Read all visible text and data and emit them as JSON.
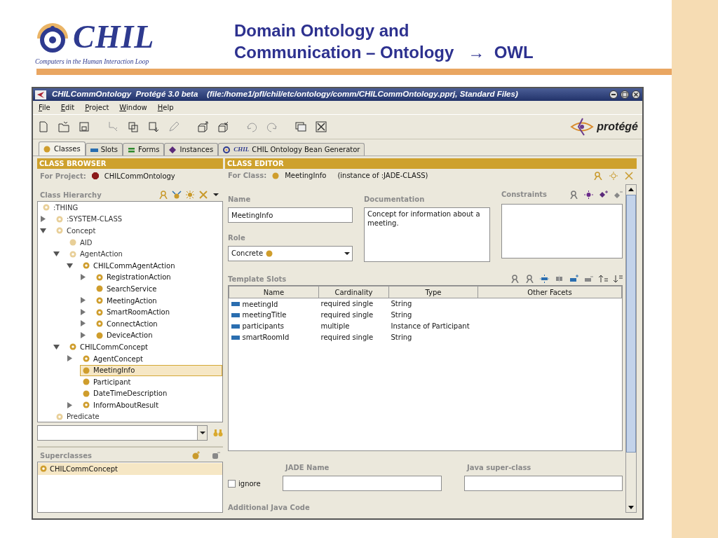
{
  "slide": {
    "logo": {
      "name": "CHIL",
      "tagline": "Computers in the Human Interaction Loop"
    },
    "title_lines": [
      "Domain Ontology and",
      "Communication – Ontology   →  OWL"
    ]
  },
  "window": {
    "title": "CHILCommOntology  Protégé 3.0 beta    (file:/home1/pfl/chil/etc/ontology/comm/CHILCommOntology.pprj, Standard Files)"
  },
  "menu": [
    "File",
    "Edit",
    "Project",
    "Window",
    "Help"
  ],
  "brand": "protégé",
  "tabs": [
    {
      "label": "Classes",
      "kind": "classes",
      "selected": true
    },
    {
      "label": "Slots",
      "kind": "slots",
      "selected": false
    },
    {
      "label": "Forms",
      "kind": "forms",
      "selected": false
    },
    {
      "label": "Instances",
      "kind": "instances",
      "selected": false
    },
    {
      "label": "CHIL Ontology Bean Generator",
      "logo": "CHIL",
      "kind": "plugin",
      "selected": false
    }
  ],
  "class_browser": {
    "header": "CLASS BROWSER",
    "project_label": "For Project:",
    "project": "CHILCommOntology",
    "hierarchy_label": "Class Hierarchy",
    "tree": [
      {
        "label": ":THING",
        "kind": "abstract",
        "system": true,
        "selected": false,
        "children": [
          {
            "label": ":SYSTEM-CLASS",
            "kind": "abstract",
            "system": true,
            "selected": false,
            "expanded": false
          },
          {
            "label": "Concept",
            "kind": "abstract",
            "system": true,
            "selected": false,
            "expanded": true,
            "children": [
              {
                "label": "AID",
                "kind": "concrete",
                "system": true,
                "selected": false
              },
              {
                "label": "AgentAction",
                "kind": "abstract",
                "system": true,
                "selected": false,
                "expanded": true,
                "children": [
                  {
                    "label": "CHILCommAgentAction",
                    "kind": "abstract",
                    "system": false,
                    "selected": false,
                    "expanded": true,
                    "children": [
                      {
                        "label": "RegistrationAction",
                        "kind": "abstract",
                        "system": false,
                        "selected": false,
                        "expanded": false
                      },
                      {
                        "label": "SearchService",
                        "kind": "concrete",
                        "system": false,
                        "selected": false
                      },
                      {
                        "label": "MeetingAction",
                        "kind": "abstract",
                        "system": false,
                        "selected": false,
                        "expanded": false
                      },
                      {
                        "label": "SmartRoomAction",
                        "kind": "abstract",
                        "system": false,
                        "selected": false,
                        "expanded": false
                      },
                      {
                        "label": "ConnectAction",
                        "kind": "abstract",
                        "system": false,
                        "selected": false,
                        "expanded": false
                      },
                      {
                        "label": "DeviceAction",
                        "kind": "concrete",
                        "system": false,
                        "selected": false,
                        "expanded": false
                      }
                    ]
                  }
                ]
              },
              {
                "label": "CHILCommConcept",
                "kind": "abstract",
                "system": false,
                "selected": false,
                "expanded": true,
                "children": [
                  {
                    "label": "AgentConcept",
                    "kind": "abstract",
                    "system": false,
                    "selected": false,
                    "expanded": false
                  },
                  {
                    "label": "MeetingInfo",
                    "kind": "concrete",
                    "system": false,
                    "selected": true
                  },
                  {
                    "label": "Participant",
                    "kind": "concrete",
                    "system": false,
                    "selected": false
                  },
                  {
                    "label": "DateTimeDescription",
                    "kind": "concrete",
                    "system": false,
                    "selected": false
                  },
                  {
                    "label": "InformAboutResult",
                    "kind": "abstract",
                    "system": false,
                    "selected": false,
                    "expanded": false
                  }
                ]
              }
            ]
          },
          {
            "label": "Predicate",
            "kind": "abstract",
            "system": true,
            "selected": false
          }
        ]
      }
    ],
    "superclasses_label": "Superclasses",
    "superclasses": [
      {
        "label": "CHILCommConcept",
        "kind": "abstract",
        "selected": true
      }
    ]
  },
  "class_editor": {
    "header": "CLASS EDITOR",
    "class_label": "For Class:",
    "class_name": "MeetingInfo",
    "instance_of": "(instance of :JADE-CLASS)",
    "name_label": "Name",
    "name_value": "MeetingInfo",
    "documentation_label": "Documentation",
    "documentation": "Concept for information about a meeting.",
    "constraints_label": "Constraints",
    "role_label": "Role",
    "role": "Concrete",
    "slots_label": "Template Slots",
    "slot_columns": [
      "Name",
      "Cardinality",
      "Type",
      "Other Facets"
    ],
    "slots": [
      {
        "name": "meetingId",
        "cardinality": "required single",
        "type": "String"
      },
      {
        "name": "meetingTitle",
        "cardinality": "required single",
        "type": "String"
      },
      {
        "name": "participants",
        "cardinality": "multiple",
        "type": "Instance of Participant"
      },
      {
        "name": "smartRoomId",
        "cardinality": "required single",
        "type": "String"
      }
    ],
    "ignore": {
      "label": "ignore",
      "checked": false
    },
    "jade_name_label": "JADE Name",
    "java_super_label": "Java super-class",
    "java_code_label": "Additional Java Code"
  }
}
